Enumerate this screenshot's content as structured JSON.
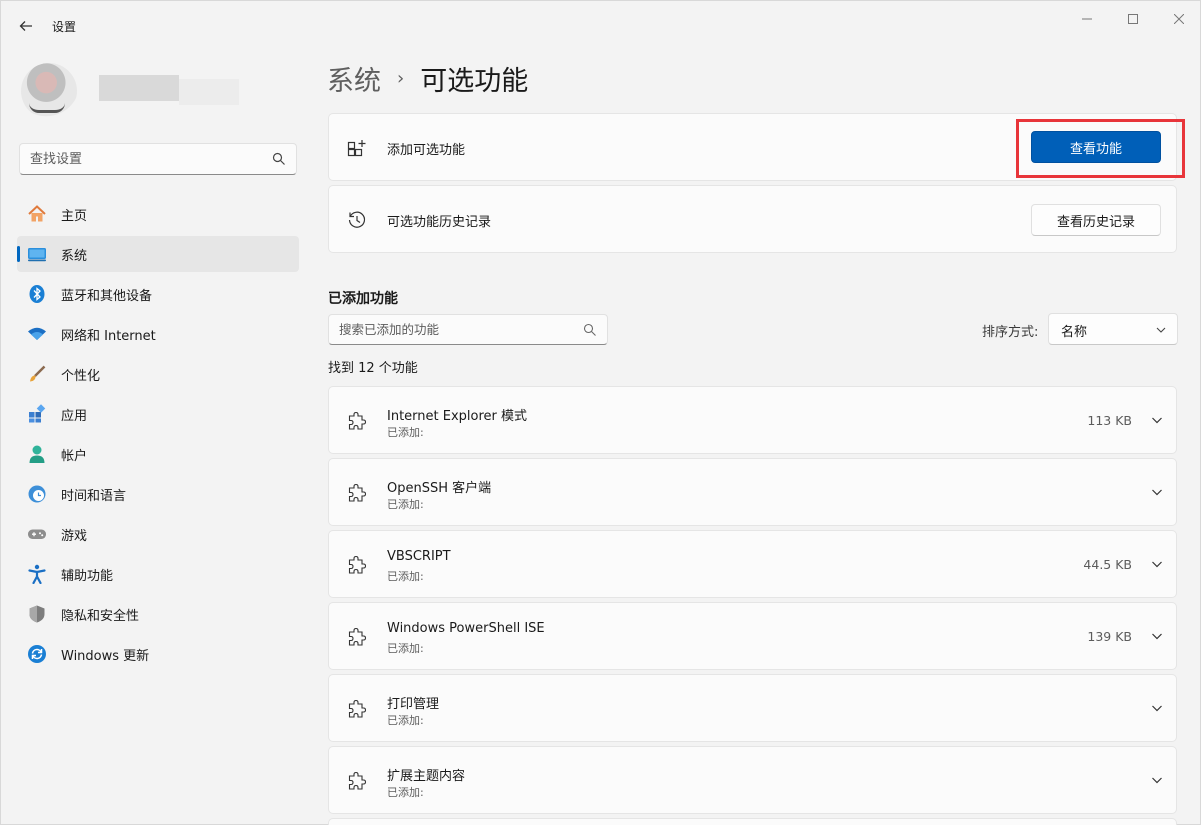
{
  "app": {
    "title": "设置"
  },
  "sidebar": {
    "search_placeholder": "查找设置",
    "items": [
      {
        "label": "主页",
        "icon": "home-icon"
      },
      {
        "label": "系统",
        "icon": "system-icon",
        "active": true
      },
      {
        "label": "蓝牙和其他设备",
        "icon": "bluetooth-icon"
      },
      {
        "label": "网络和 Internet",
        "icon": "wifi-icon"
      },
      {
        "label": "个性化",
        "icon": "brush-icon"
      },
      {
        "label": "应用",
        "icon": "apps-icon"
      },
      {
        "label": "帐户",
        "icon": "account-icon"
      },
      {
        "label": "时间和语言",
        "icon": "clock-globe-icon"
      },
      {
        "label": "游戏",
        "icon": "gamepad-icon"
      },
      {
        "label": "辅助功能",
        "icon": "accessibility-icon"
      },
      {
        "label": "隐私和安全性",
        "icon": "shield-icon"
      },
      {
        "label": "Windows 更新",
        "icon": "update-icon"
      }
    ]
  },
  "breadcrumb": {
    "parent": "系统",
    "separator": "›",
    "current": "可选功能"
  },
  "add_card": {
    "label": "添加可选功能",
    "button": "查看功能"
  },
  "history_card": {
    "label": "可选功能历史记录",
    "button": "查看历史记录"
  },
  "installed": {
    "title": "已添加功能",
    "search_placeholder": "搜索已添加的功能",
    "sort_label": "排序方式:",
    "sort_value": "名称",
    "found_text": "找到 12 个功能",
    "features": [
      {
        "name": "Internet Explorer 模式",
        "status": "已添加:",
        "size": "113 KB"
      },
      {
        "name": "OpenSSH 客户端",
        "status": "已添加:",
        "size": ""
      },
      {
        "name": "VBSCRIPT",
        "status": "已添加:",
        "size": "44.5 KB"
      },
      {
        "name": "Windows PowerShell ISE",
        "status": "已添加:",
        "size": "139 KB"
      },
      {
        "name": "打印管理",
        "status": "已添加:",
        "size": ""
      },
      {
        "name": "扩展主题内容",
        "status": "已添加:",
        "size": ""
      }
    ]
  },
  "colors": {
    "accent": "#005fb8",
    "highlight": "#e8353a",
    "nav_indicator": "#0067c0"
  }
}
